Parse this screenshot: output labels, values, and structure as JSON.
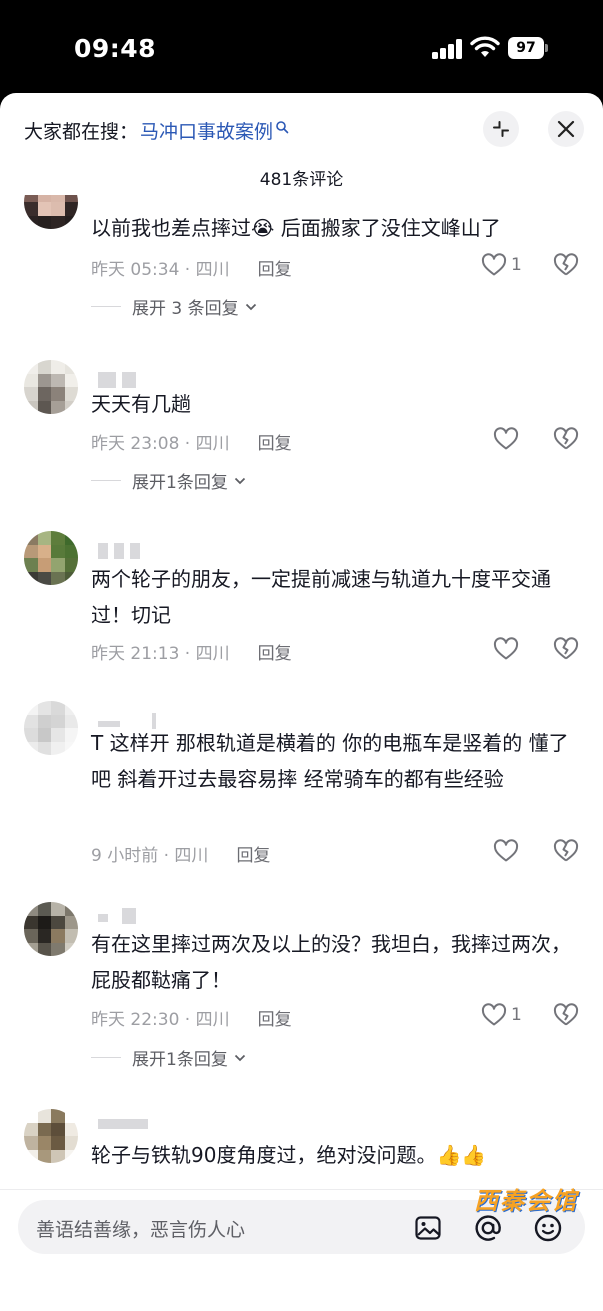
{
  "status_bar": {
    "time": "09:48",
    "battery": "97"
  },
  "header": {
    "search_prefix": "大家都在搜：",
    "search_term": "马冲口事故案例",
    "comment_count": "481条评论"
  },
  "comments": [
    {
      "text": "以前我也差点摔过😭 后面搬家了没住文峰山了",
      "time": "昨天 05:34 · 四川",
      "reply": "回复",
      "likes": "1",
      "expand": "展开 3 条回复"
    },
    {
      "text": "天天有几趟",
      "time": "昨天 23:08 · 四川",
      "reply": "回复",
      "likes": "",
      "expand": "展开1条回复"
    },
    {
      "text": "两个轮子的朋友，一定提前减速与轨道九十度平交通过！切记",
      "time": "昨天 21:13 · 四川",
      "reply": "回复",
      "likes": "",
      "expand": ""
    },
    {
      "text": "T   这样开  那根轨道是横着的  你的电瓶车是竖着的  懂了吧  斜着开过去最容易摔  经常骑车的都有些经验",
      "time": "9 小时前 · 四川",
      "reply": "回复",
      "likes": "",
      "expand": ""
    },
    {
      "text": "有在这里摔过两次及以上的没？我坦白，我摔过两次，屁股都鞑痛了！",
      "time": "昨天 22:30 · 四川",
      "reply": "回复",
      "likes": "1",
      "expand": "展开1条回复"
    },
    {
      "text": "轮子与铁轨90度角度过，绝对没问题。👍👍",
      "time": "",
      "reply": "",
      "likes": "",
      "expand": ""
    }
  ],
  "input": {
    "placeholder": "善语结善缘，恶言伤人心"
  },
  "icons": {
    "search_hint": "search-icon",
    "collapse": "collapse-icon",
    "close": "close-icon",
    "like": "heart-icon",
    "dislike": "broken-heart-icon",
    "image": "image-icon",
    "mention": "at-icon",
    "emoji": "emoji-icon"
  },
  "watermark": "西秦会馆",
  "colors": {
    "link": "#2b58b5",
    "text": "#161823",
    "meta": "#9d9ea3",
    "watermark": "#f6a224"
  }
}
